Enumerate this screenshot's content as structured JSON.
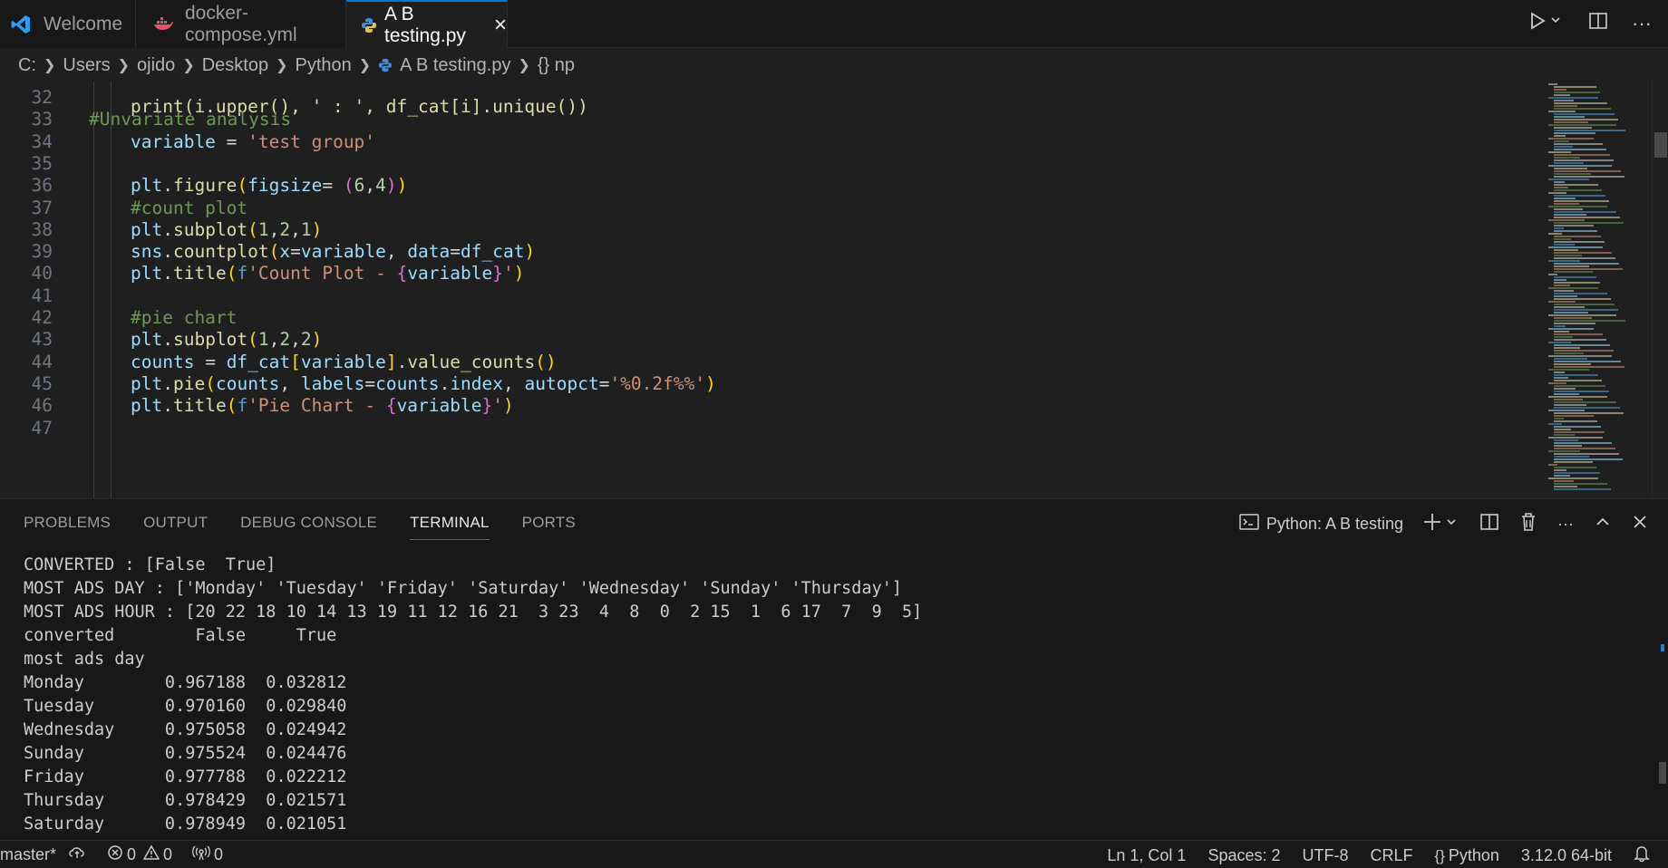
{
  "tabs": [
    {
      "label": "Welcome",
      "icon": "vscode-logo-icon"
    },
    {
      "label": "docker-compose.yml",
      "icon": "docker-icon"
    },
    {
      "label": "A B testing.py",
      "icon": "python-icon",
      "active": true
    }
  ],
  "breadcrumb": [
    "C:",
    "Users",
    "ojido",
    "Desktop",
    "Python",
    "A B testing.py",
    "{} np"
  ],
  "editor": {
    "partial_line": "print(i.upper(), ' : ', df_cat[i].unique())",
    "lines": [
      {
        "num": "32",
        "text": ""
      },
      {
        "num": "33",
        "text": "#Unvariate analysis"
      },
      {
        "num": "34",
        "text": "variable = 'test group'"
      },
      {
        "num": "35",
        "text": ""
      },
      {
        "num": "36",
        "text": "plt.figure(figsize= (6,4))"
      },
      {
        "num": "37",
        "text": "#count plot"
      },
      {
        "num": "38",
        "text": "plt.subplot(1,2,1)"
      },
      {
        "num": "39",
        "text": "sns.countplot(x=variable, data=df_cat)"
      },
      {
        "num": "40",
        "text": "plt.title(f'Count Plot - {variable}')"
      },
      {
        "num": "41",
        "text": ""
      },
      {
        "num": "42",
        "text": "#pie chart"
      },
      {
        "num": "43",
        "text": "plt.subplot(1,2,2)"
      },
      {
        "num": "44",
        "text": "counts = df_cat[variable].value_counts()"
      },
      {
        "num": "45",
        "text": "plt.pie(counts, labels=counts.index, autopct='%0.2f%%')"
      },
      {
        "num": "46",
        "text": "plt.title(f'Pie Chart - {variable}')"
      },
      {
        "num": "47",
        "text": ""
      }
    ]
  },
  "panel": {
    "tabs": [
      "PROBLEMS",
      "OUTPUT",
      "DEBUG CONSOLE",
      "TERMINAL",
      "PORTS"
    ],
    "active_tab": "TERMINAL",
    "terminal_name": "Python: A B testing",
    "terminal_lines": [
      "CONVERTED : [False  True]",
      "MOST ADS DAY : ['Monday' 'Tuesday' 'Friday' 'Saturday' 'Wednesday' 'Sunday' 'Thursday']",
      "MOST ADS HOUR : [20 22 18 10 14 13 19 11 12 16 21  3 23  4  8  0  2 15  1  6 17  7  9  5]",
      "converted        False     True",
      "most ads day",
      "Monday        0.967188  0.032812",
      "Tuesday       0.970160  0.029840",
      "Wednesday     0.975058  0.024942",
      "Sunday        0.975524  0.024476",
      "Friday        0.977788  0.022212",
      "Thursday      0.978429  0.021571",
      "Saturday      0.978949  0.021051"
    ]
  },
  "statusbar": {
    "branch": "master*",
    "errors": "0",
    "warnings": "0",
    "ports": "0",
    "position": "Ln 1, Col 1",
    "spaces": "Spaces: 2",
    "encoding": "UTF-8",
    "eol": "CRLF",
    "language": "Python",
    "interpreter": "3.12.0 64-bit"
  },
  "colors": {
    "accent": "#0078d4",
    "background": "#1f1f1f",
    "chrome": "#181818"
  }
}
